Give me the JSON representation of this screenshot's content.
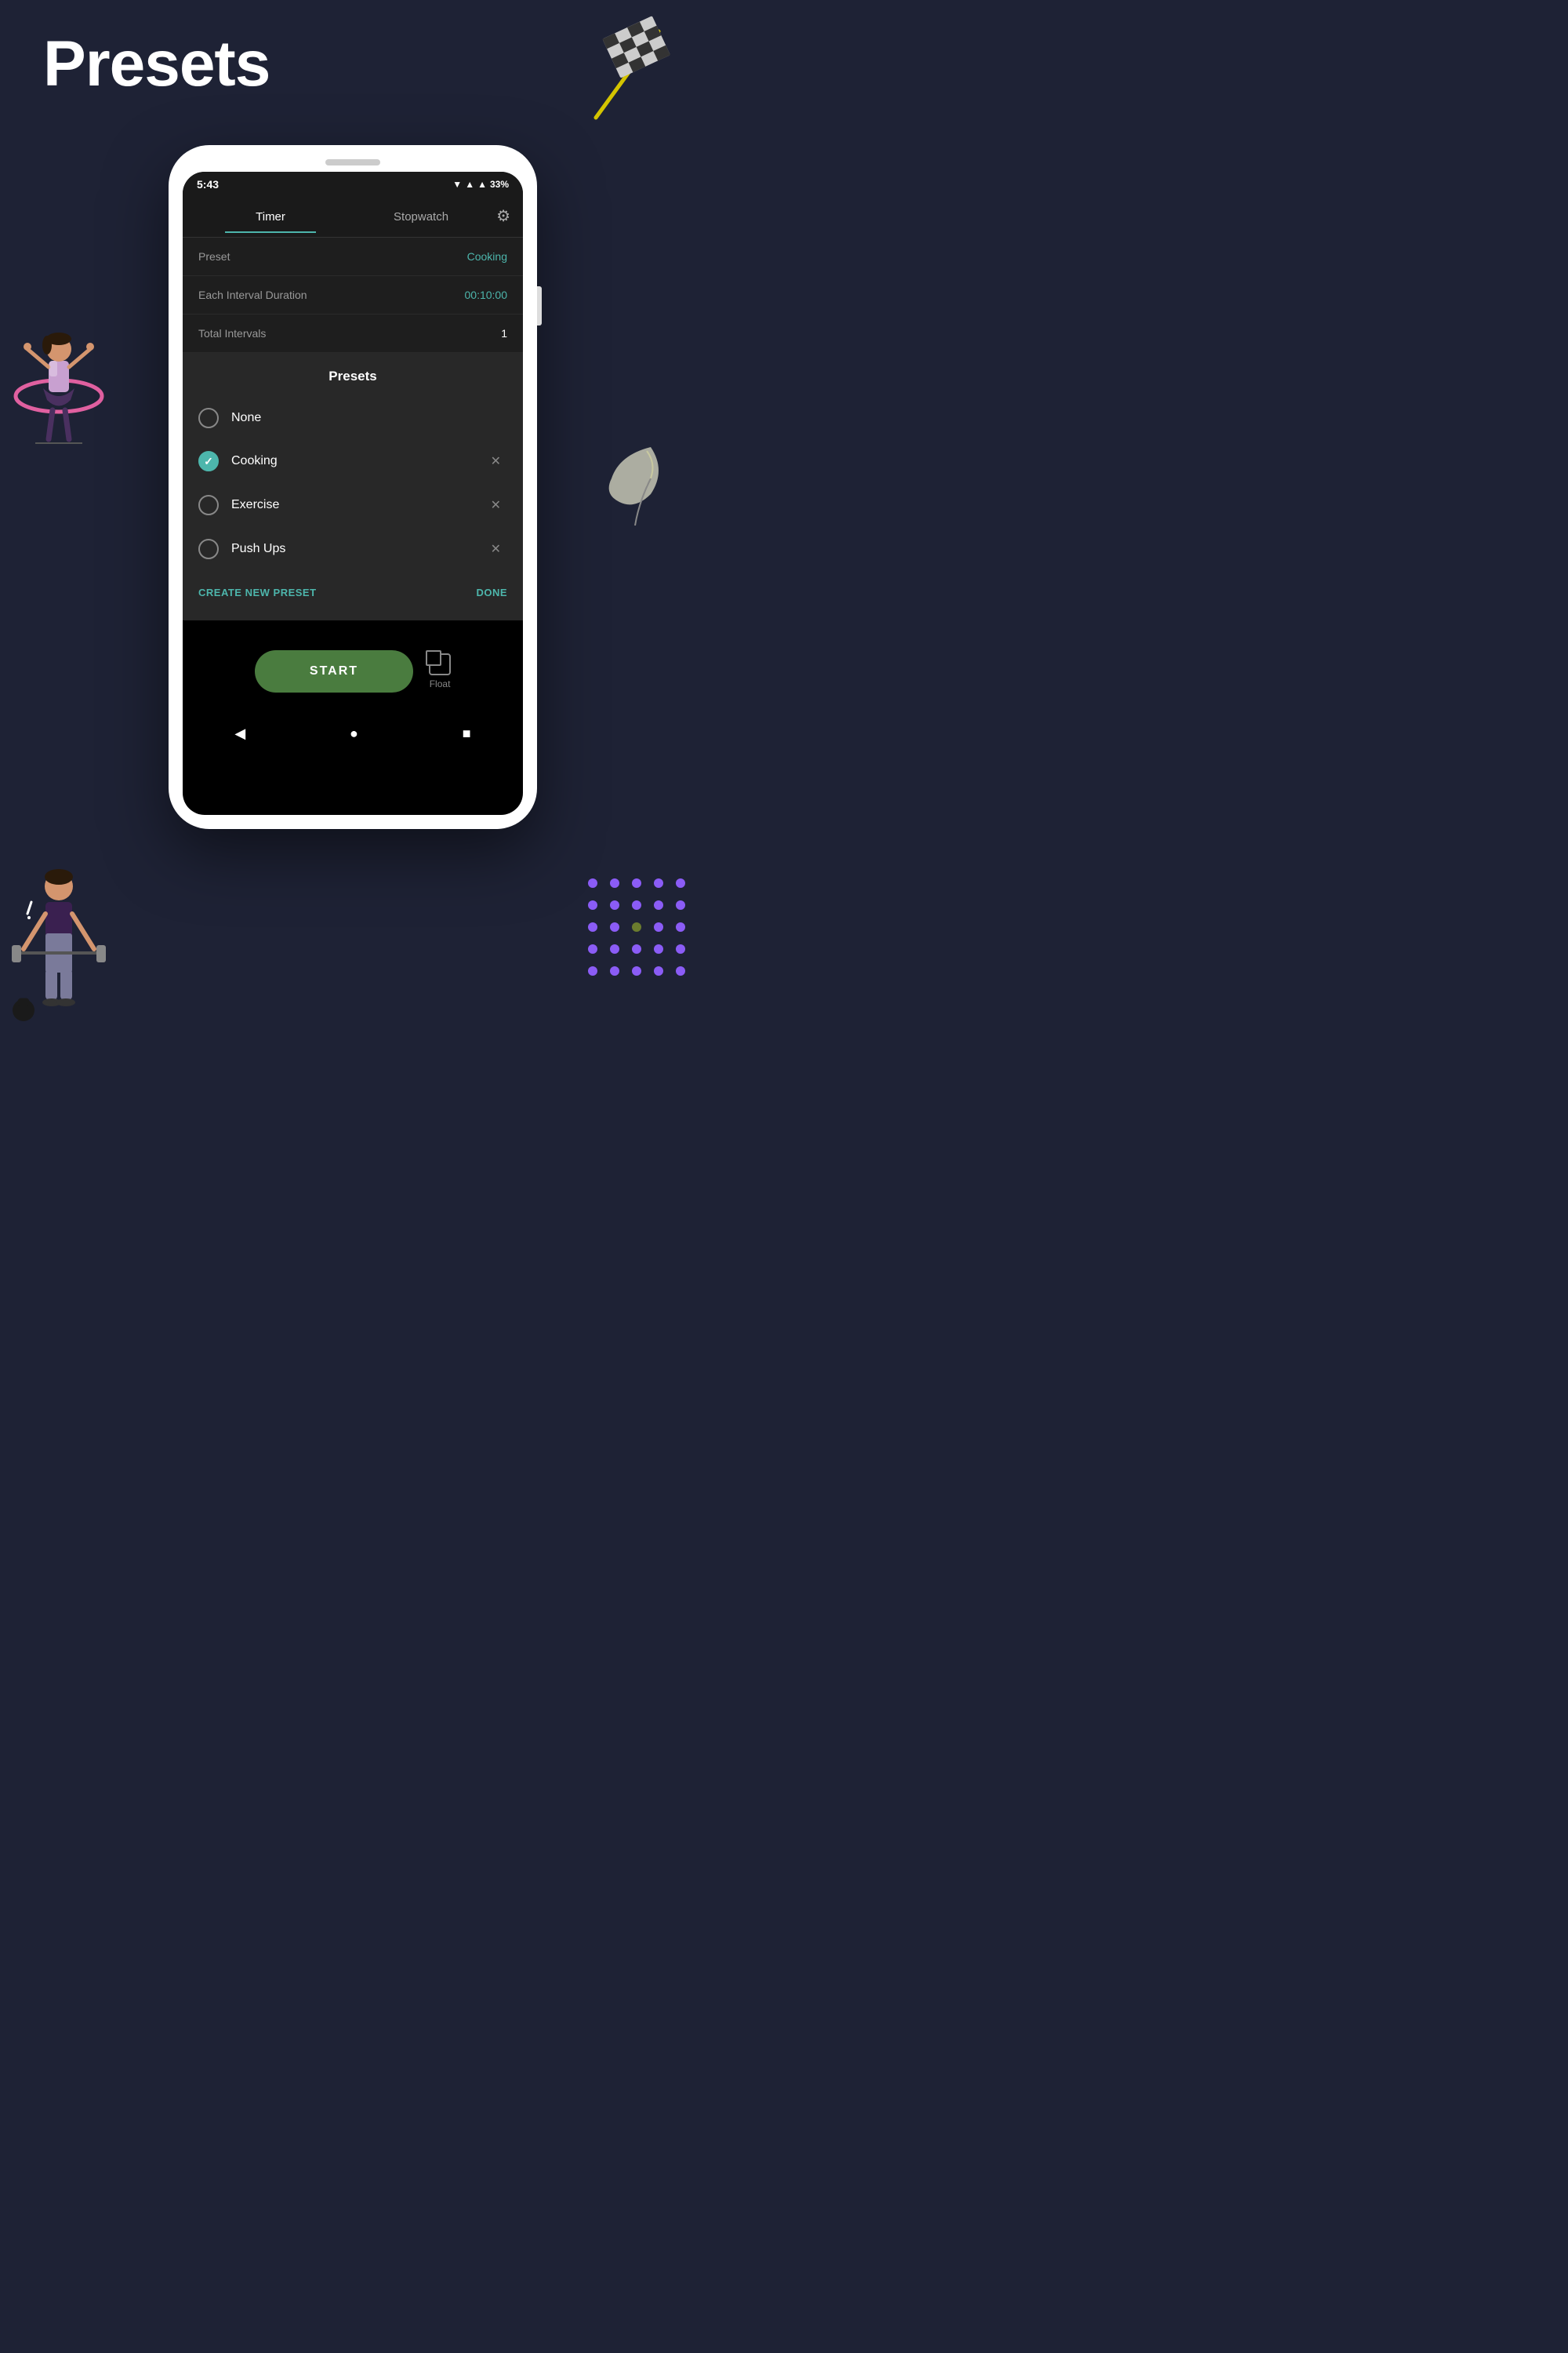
{
  "page": {
    "title": "Presets",
    "background_color": "#1e2235"
  },
  "status_bar": {
    "time": "5:43",
    "battery": "33%",
    "signal_icons": "▼▲"
  },
  "nav_tabs": {
    "timer_label": "Timer",
    "stopwatch_label": "Stopwatch",
    "active_tab": "timer",
    "settings_icon": "⚙"
  },
  "timer_settings": {
    "preset_label": "Preset",
    "preset_value": "Cooking",
    "interval_label": "Each Interval Duration",
    "interval_value": "00:10:00",
    "total_label": "Total Intervals",
    "total_value": "1"
  },
  "presets_modal": {
    "title": "Presets",
    "items": [
      {
        "id": "none",
        "name": "None",
        "checked": false,
        "deletable": false
      },
      {
        "id": "cooking",
        "name": "Cooking",
        "checked": true,
        "deletable": true
      },
      {
        "id": "exercise",
        "name": "Exercise",
        "checked": false,
        "deletable": true
      },
      {
        "id": "pushups",
        "name": "Push Ups",
        "checked": false,
        "deletable": true
      }
    ],
    "create_label": "CREATE NEW PRESET",
    "done_label": "DONE"
  },
  "bottom_actions": {
    "start_label": "START",
    "float_label": "Float"
  },
  "sys_nav": {
    "back": "◀",
    "home": "●",
    "recents": "■"
  },
  "dots": [
    "purple",
    "purple",
    "purple",
    "purple",
    "purple",
    "purple",
    "purple",
    "purple",
    "purple",
    "purple",
    "purple",
    "purple",
    "olive",
    "purple",
    "purple",
    "purple",
    "purple",
    "purple",
    "purple",
    "purple",
    "purple",
    "purple",
    "purple",
    "purple",
    "purple"
  ],
  "colors": {
    "accent": "#4db6ac",
    "background": "#1e2235",
    "phone_bg": "#ffffff",
    "screen_bg": "#000000",
    "modal_bg": "#282828",
    "settings_bg": "#1e1e1e",
    "start_btn": "#4a7c3f"
  }
}
